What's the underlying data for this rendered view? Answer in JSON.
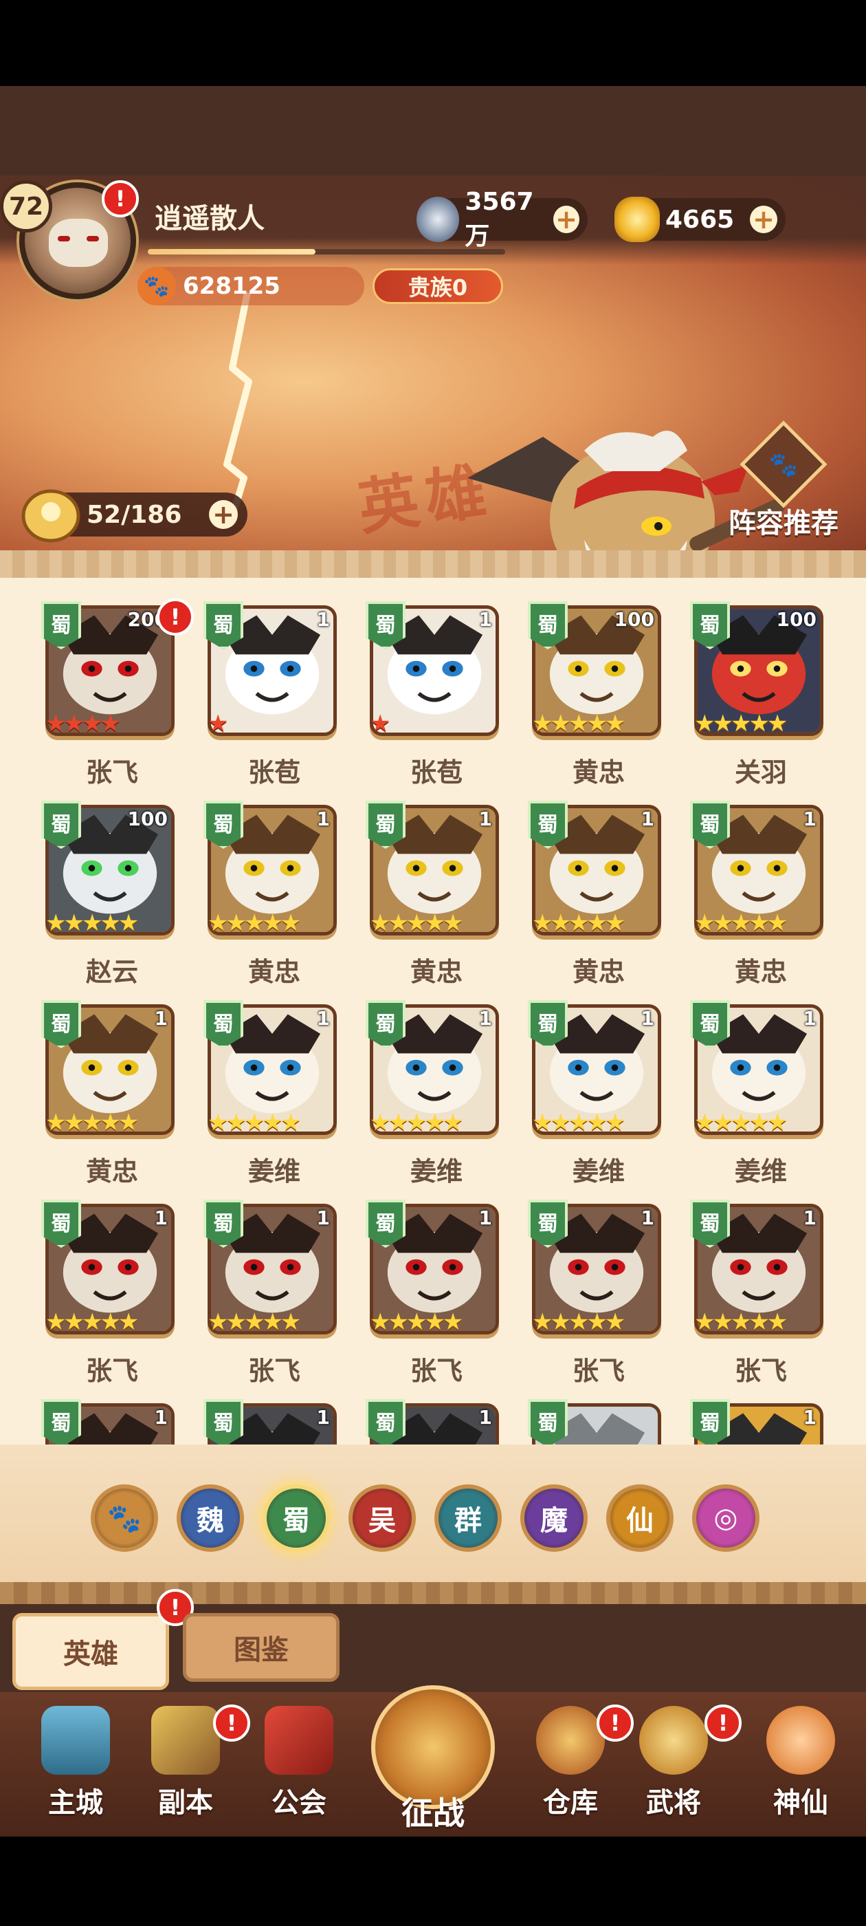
{
  "player": {
    "level": "72",
    "name": "逍遥散人",
    "power": "628125",
    "noble": "贵族0",
    "exp_fraction": 0.47
  },
  "resources": {
    "coins": "3567万",
    "gold": "4665"
  },
  "banner": {
    "watermark": "英雄",
    "hero_count": "52/186",
    "lineup_label": "阵容推荐"
  },
  "heroes": [
    {
      "faction": "蜀",
      "level": "200",
      "stars": 4,
      "star_color": "red",
      "name": "张飞",
      "portrait": "zhangfei",
      "alert": true
    },
    {
      "faction": "蜀",
      "level": "1",
      "stars": 1,
      "star_color": "red",
      "name": "张苞",
      "portrait": "zhangbao"
    },
    {
      "faction": "蜀",
      "level": "1",
      "stars": 1,
      "star_color": "red",
      "name": "张苞",
      "portrait": "zhangbao"
    },
    {
      "faction": "蜀",
      "level": "100",
      "stars": 5,
      "star_color": "gold",
      "name": "黄忠",
      "portrait": "huangzhong"
    },
    {
      "faction": "蜀",
      "level": "100",
      "stars": 5,
      "star_color": "gold",
      "name": "关羽",
      "portrait": "guanyu"
    },
    {
      "faction": "蜀",
      "level": "100",
      "stars": 5,
      "star_color": "gold",
      "name": "赵云",
      "portrait": "zhaoyun"
    },
    {
      "faction": "蜀",
      "level": "1",
      "stars": 5,
      "star_color": "gold",
      "name": "黄忠",
      "portrait": "huangzhong"
    },
    {
      "faction": "蜀",
      "level": "1",
      "stars": 5,
      "star_color": "gold",
      "name": "黄忠",
      "portrait": "huangzhong"
    },
    {
      "faction": "蜀",
      "level": "1",
      "stars": 5,
      "star_color": "gold",
      "name": "黄忠",
      "portrait": "huangzhong"
    },
    {
      "faction": "蜀",
      "level": "1",
      "stars": 5,
      "star_color": "gold",
      "name": "黄忠",
      "portrait": "huangzhong"
    },
    {
      "faction": "蜀",
      "level": "1",
      "stars": 5,
      "star_color": "gold",
      "name": "黄忠",
      "portrait": "huangzhong"
    },
    {
      "faction": "蜀",
      "level": "1",
      "stars": 5,
      "star_color": "gold",
      "name": "姜维",
      "portrait": "jiangwei"
    },
    {
      "faction": "蜀",
      "level": "1",
      "stars": 5,
      "star_color": "gold",
      "name": "姜维",
      "portrait": "jiangwei"
    },
    {
      "faction": "蜀",
      "level": "1",
      "stars": 5,
      "star_color": "gold",
      "name": "姜维",
      "portrait": "jiangwei"
    },
    {
      "faction": "蜀",
      "level": "1",
      "stars": 5,
      "star_color": "gold",
      "name": "姜维",
      "portrait": "jiangwei"
    },
    {
      "faction": "蜀",
      "level": "1",
      "stars": 5,
      "star_color": "gold",
      "name": "张飞",
      "portrait": "zhangfei"
    },
    {
      "faction": "蜀",
      "level": "1",
      "stars": 5,
      "star_color": "gold",
      "name": "张飞",
      "portrait": "zhangfei"
    },
    {
      "faction": "蜀",
      "level": "1",
      "stars": 5,
      "star_color": "gold",
      "name": "张飞",
      "portrait": "zhangfei"
    },
    {
      "faction": "蜀",
      "level": "1",
      "stars": 5,
      "star_color": "gold",
      "name": "张飞",
      "portrait": "zhangfei"
    },
    {
      "faction": "蜀",
      "level": "1",
      "stars": 5,
      "star_color": "gold",
      "name": "张飞",
      "portrait": "zhangfei"
    },
    {
      "faction": "蜀",
      "level": "1",
      "stars": 0,
      "star_color": "gold",
      "name": "",
      "portrait": "zhangfei"
    },
    {
      "faction": "蜀",
      "level": "1",
      "stars": 0,
      "star_color": "gold",
      "name": "",
      "portrait": "dark"
    },
    {
      "faction": "蜀",
      "level": "1",
      "stars": 0,
      "star_color": "gold",
      "name": "",
      "portrait": "dark"
    },
    {
      "faction": "蜀",
      "level": "",
      "stars": 0,
      "star_color": "gold",
      "name": "",
      "portrait": "silver"
    },
    {
      "faction": "蜀",
      "level": "1",
      "stars": 0,
      "star_color": "gold",
      "name": "",
      "portrait": "taiji"
    }
  ],
  "filters": [
    {
      "label": "🐾",
      "color": "#c98a3e",
      "name": "all"
    },
    {
      "label": "魏",
      "color": "#3d62a8",
      "name": "wei"
    },
    {
      "label": "蜀",
      "color": "#3e8a4d",
      "name": "shu",
      "active": true
    },
    {
      "label": "吴",
      "color": "#b8352e",
      "name": "wu"
    },
    {
      "label": "群",
      "color": "#2f7b86",
      "name": "qun"
    },
    {
      "label": "魔",
      "color": "#6a3e9a",
      "name": "mo"
    },
    {
      "label": "仙",
      "color": "#d08a1f",
      "name": "xian"
    },
    {
      "label": "◎",
      "color": "#c24aa6",
      "name": "special"
    }
  ],
  "tabs": {
    "heroes": "英雄",
    "codex": "图鉴"
  },
  "nav": {
    "city": "主城",
    "dungeon": "副本",
    "guild": "公会",
    "battle": "征战",
    "warehouse": "仓库",
    "generals": "武将",
    "immortal": "神仙"
  },
  "colors": {
    "faction_shu": "#3e8a4d",
    "alert_red": "#e0261f",
    "panel_bg": "#fbefd9"
  }
}
